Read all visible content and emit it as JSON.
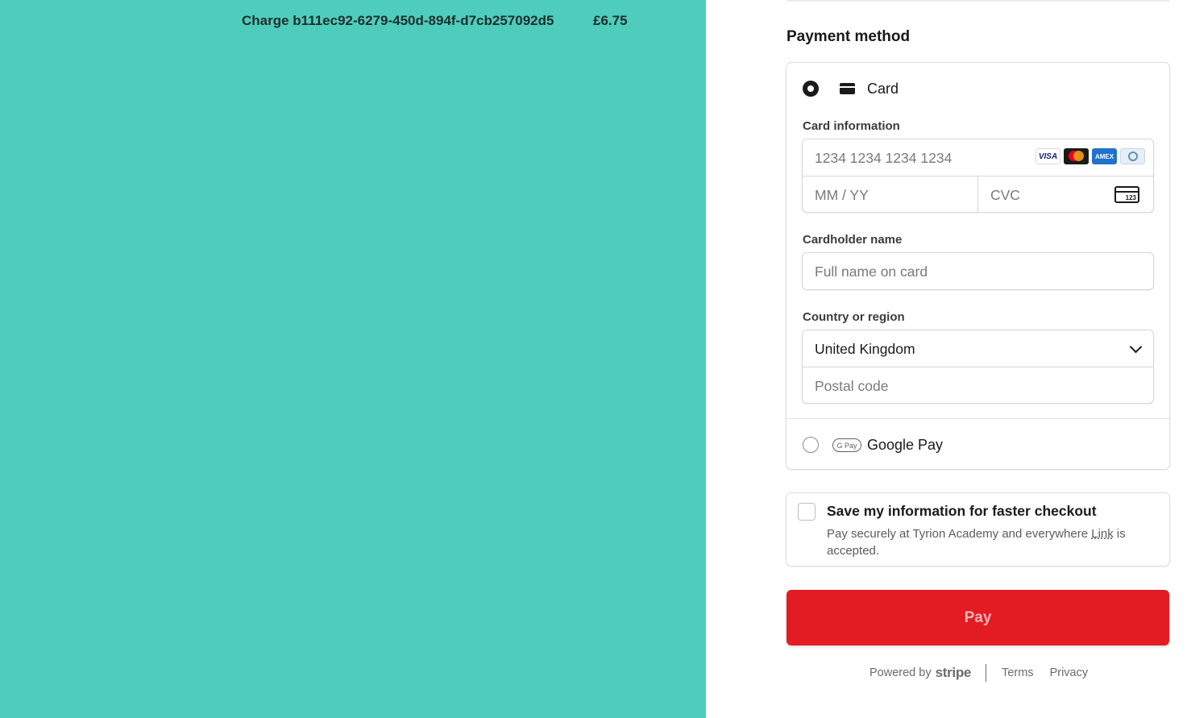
{
  "summary": {
    "charge_description": "Charge b111ec92-6279-450d-894f-d7cb257092d5",
    "charge_amount": "£6.75"
  },
  "payment": {
    "section_title": "Payment method",
    "card_option_label": "Card",
    "card_information_label": "Card information",
    "card_number_placeholder": "1234 1234 1234 1234",
    "card_brands": [
      "VISA",
      "mastercard",
      "AMEX",
      "diners"
    ],
    "expiry_placeholder": "MM / YY",
    "cvc_placeholder": "CVC",
    "cvc_icon_text": "123",
    "cardholder_label": "Cardholder name",
    "cardholder_placeholder": "Full name on card",
    "country_label": "Country or region",
    "country_value": "United Kingdom",
    "postal_placeholder": "Postal code",
    "gpay_badge": "G Pay",
    "gpay_label": "Google Pay"
  },
  "save_info": {
    "title": "Save my information for faster checkout",
    "desc_prefix": "Pay securely at Tyrion Academy and everywhere ",
    "desc_link": "Link",
    "desc_suffix": " is accepted."
  },
  "pay_button_label": "Pay",
  "footer": {
    "powered_by": "Powered by",
    "stripe": "stripe",
    "terms": "Terms",
    "privacy": "Privacy"
  },
  "colors": {
    "left_pane_bg": "#4ecdbd",
    "pay_button_bg": "#e31b23"
  }
}
